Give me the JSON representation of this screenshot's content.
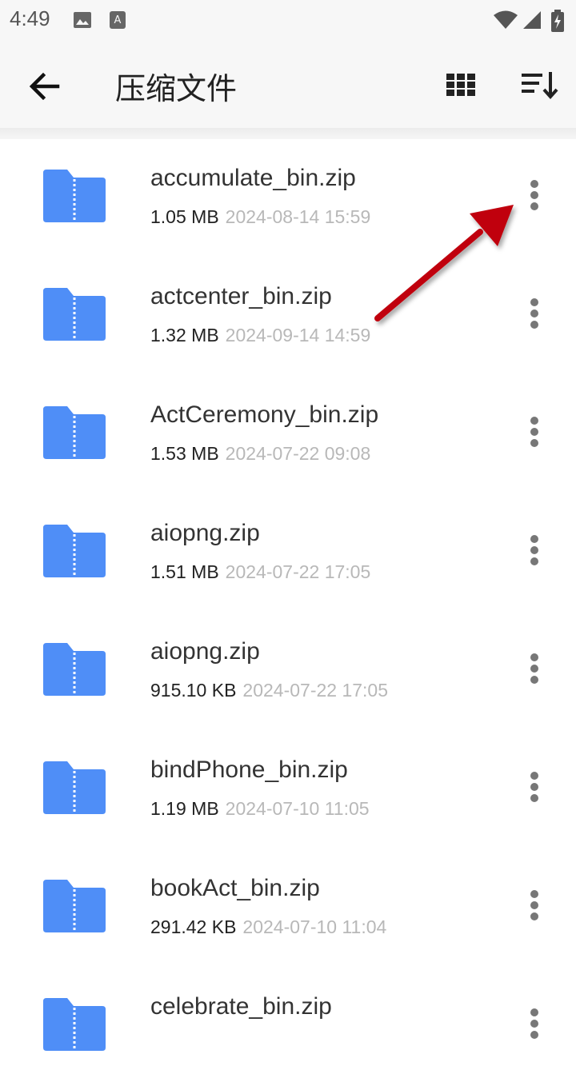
{
  "status_bar": {
    "time": "4:49",
    "icons": [
      "image-icon",
      "text-a-icon",
      "wifi-icon",
      "signal-icon",
      "battery-charging-icon"
    ]
  },
  "app_bar": {
    "title": "压缩文件",
    "back_icon": "arrow-left-icon",
    "grid_icon": "grid-view-icon",
    "sort_icon": "sort-icon"
  },
  "files": [
    {
      "name": "accumulate_bin.zip",
      "size": "1.05 MB",
      "date": "2024-08-14 15:59"
    },
    {
      "name": "actcenter_bin.zip",
      "size": "1.32 MB",
      "date": "2024-09-14 14:59"
    },
    {
      "name": "ActCeremony_bin.zip",
      "size": "1.53 MB",
      "date": "2024-07-22 09:08"
    },
    {
      "name": "aiopng.zip",
      "size": "1.51 MB",
      "date": "2024-07-22 17:05"
    },
    {
      "name": "aiopng.zip",
      "size": "915.10 KB",
      "date": "2024-07-22 17:05"
    },
    {
      "name": "bindPhone_bin.zip",
      "size": "1.19 MB",
      "date": "2024-07-10 11:05"
    },
    {
      "name": "bookAct_bin.zip",
      "size": "291.42 KB",
      "date": "2024-07-10 11:04"
    },
    {
      "name": "celebrate_bin.zip",
      "size": "",
      "date": ""
    }
  ],
  "colors": {
    "folder": "#4f8ef7",
    "annotation_arrow": "#c0000e"
  }
}
